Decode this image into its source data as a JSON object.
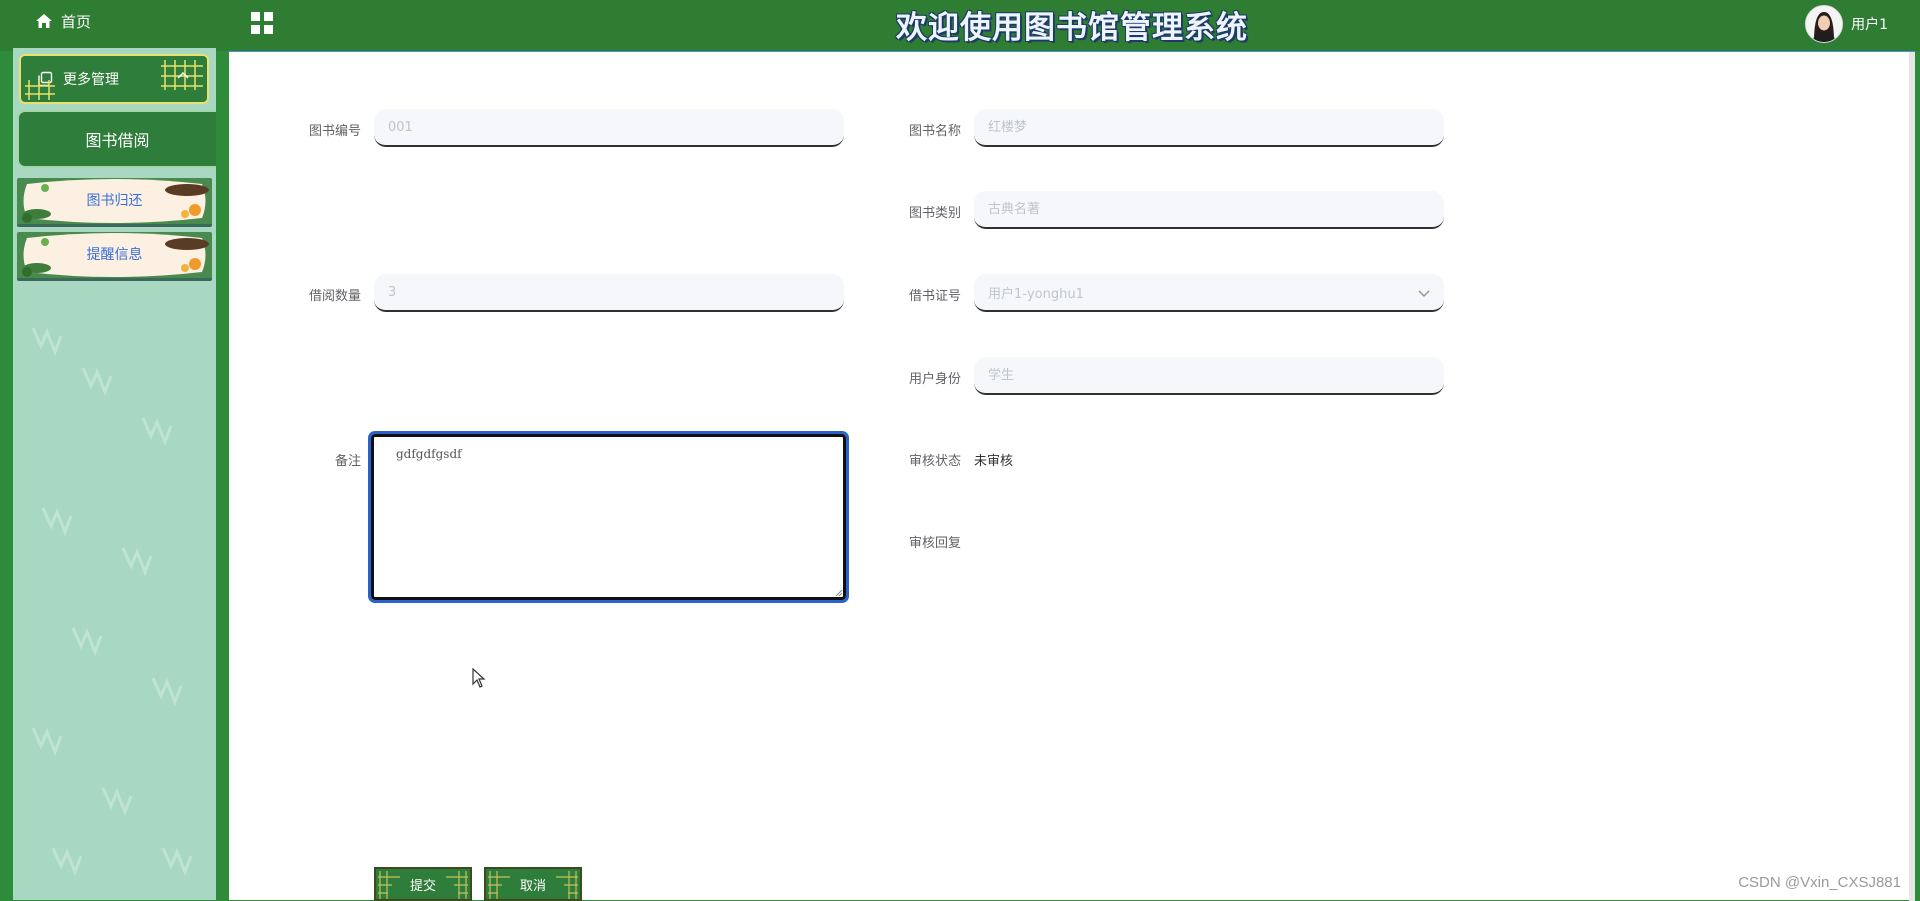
{
  "header": {
    "home_label": "首页",
    "title": "欢迎使用图书馆管理系统",
    "user_label": "用户1"
  },
  "sidebar": {
    "group_label": "更多管理",
    "items": [
      {
        "label": "图书借阅",
        "active": true
      },
      {
        "label": "图书归还",
        "active": false
      },
      {
        "label": "提醒信息",
        "active": false
      }
    ]
  },
  "form": {
    "book_no": {
      "label": "图书编号",
      "placeholder": "001"
    },
    "book_name": {
      "label": "图书名称",
      "placeholder": "红楼梦"
    },
    "book_category": {
      "label": "图书类别",
      "placeholder": "古典名著"
    },
    "borrow_qty": {
      "label": "借阅数量",
      "placeholder": "3"
    },
    "card_no": {
      "label": "借书证号",
      "value": "用户1-yonghu1"
    },
    "identity": {
      "label": "用户身份",
      "placeholder": "学生"
    },
    "remark": {
      "label": "备注",
      "value": "gdfgdfgsdf"
    },
    "review_status": {
      "label": "审核状态",
      "value": "未审核"
    },
    "review_reply": {
      "label": "审核回复",
      "value": ""
    },
    "submit_label": "提交",
    "cancel_label": "取消"
  },
  "watermark": "CSDN @Vxin_CXSJ881",
  "colors": {
    "topbar": "#2e7d32",
    "sidebar": "#a8d8c2",
    "active_menu": "#2f7d3a",
    "focus_outline": "#2a62c9"
  }
}
